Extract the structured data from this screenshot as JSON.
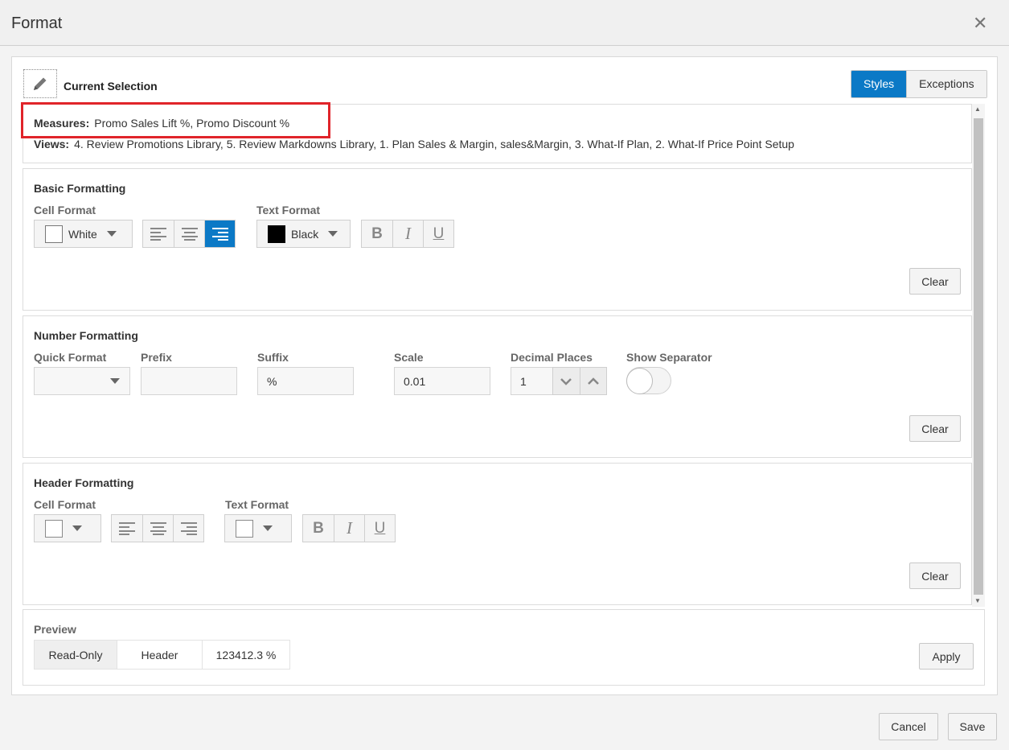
{
  "dialog": {
    "title": "Format"
  },
  "selection": {
    "heading": "Current Selection",
    "measures_label": "Measures:",
    "measures_value": "Promo Sales Lift %, Promo Discount %",
    "views_label": "Views:",
    "views_value": "4. Review Promotions Library, 5. Review Markdowns Library, 1. Plan Sales & Margin, sales&Margin, 3. What-If Plan, 2. What-If Price Point Setup"
  },
  "tabs": [
    {
      "label": "Styles",
      "active": true
    },
    {
      "label": "Exceptions",
      "active": false
    }
  ],
  "basic": {
    "title": "Basic Formatting",
    "cell_format_label": "Cell Format",
    "cell_color": "White",
    "cell_alignment_selected": "right",
    "text_format_label": "Text Format",
    "text_color": "Black",
    "bold_glyph": "B",
    "italic_glyph": "I",
    "underline_glyph": "U",
    "clear_label": "Clear"
  },
  "number": {
    "title": "Number Formatting",
    "quick_format_label": "Quick Format",
    "quick_format_value": "",
    "prefix_label": "Prefix",
    "prefix_value": "",
    "suffix_label": "Suffix",
    "suffix_value": "%",
    "scale_label": "Scale",
    "scale_value": "0.01",
    "decimal_label": "Decimal Places",
    "decimal_value": "1",
    "separator_label": "Show Separator",
    "separator_on": false,
    "clear_label": "Clear"
  },
  "header": {
    "title": "Header Formatting",
    "cell_format_label": "Cell Format",
    "text_format_label": "Text Format",
    "bold_glyph": "B",
    "italic_glyph": "I",
    "underline_glyph": "U",
    "clear_label": "Clear"
  },
  "preview": {
    "label": "Preview",
    "readonly": "Read-Only",
    "header": "Header",
    "value": "123412.3 %",
    "apply_label": "Apply"
  },
  "footer": {
    "cancel_label": "Cancel",
    "save_label": "Save"
  },
  "colors": {
    "accent": "#0b79c6",
    "highlight_box": "#e0242a"
  }
}
